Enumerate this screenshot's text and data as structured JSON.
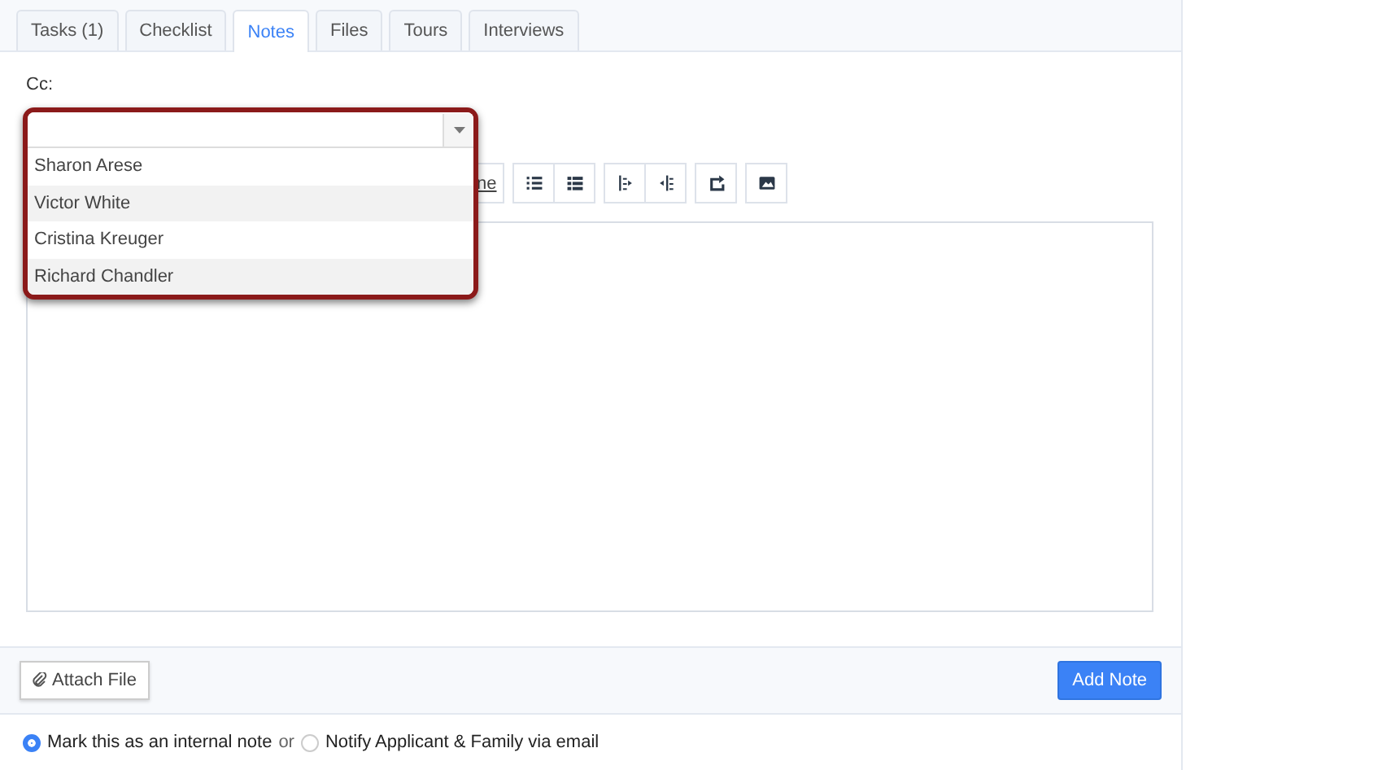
{
  "tabs": [
    {
      "label": "Tasks (1)",
      "selected": false
    },
    {
      "label": "Checklist",
      "selected": false
    },
    {
      "label": "Notes",
      "selected": true
    },
    {
      "label": "Files",
      "selected": false
    },
    {
      "label": "Tours",
      "selected": false
    },
    {
      "label": "Interviews",
      "selected": false
    }
  ],
  "cc": {
    "label": "Cc:",
    "options": [
      "Sharon Arese",
      "Victor White",
      "Cristina Kreuger",
      "Richard Chandler"
    ]
  },
  "toolbar": {
    "partial_label": "ne"
  },
  "attach_button": "Attach File",
  "add_button": "Add Note",
  "visibility": {
    "options": [
      {
        "label": "Mark this as an internal note",
        "selected": true
      },
      {
        "label": "Notify Applicant & Family via email",
        "selected": false
      }
    ],
    "separator": "or"
  }
}
